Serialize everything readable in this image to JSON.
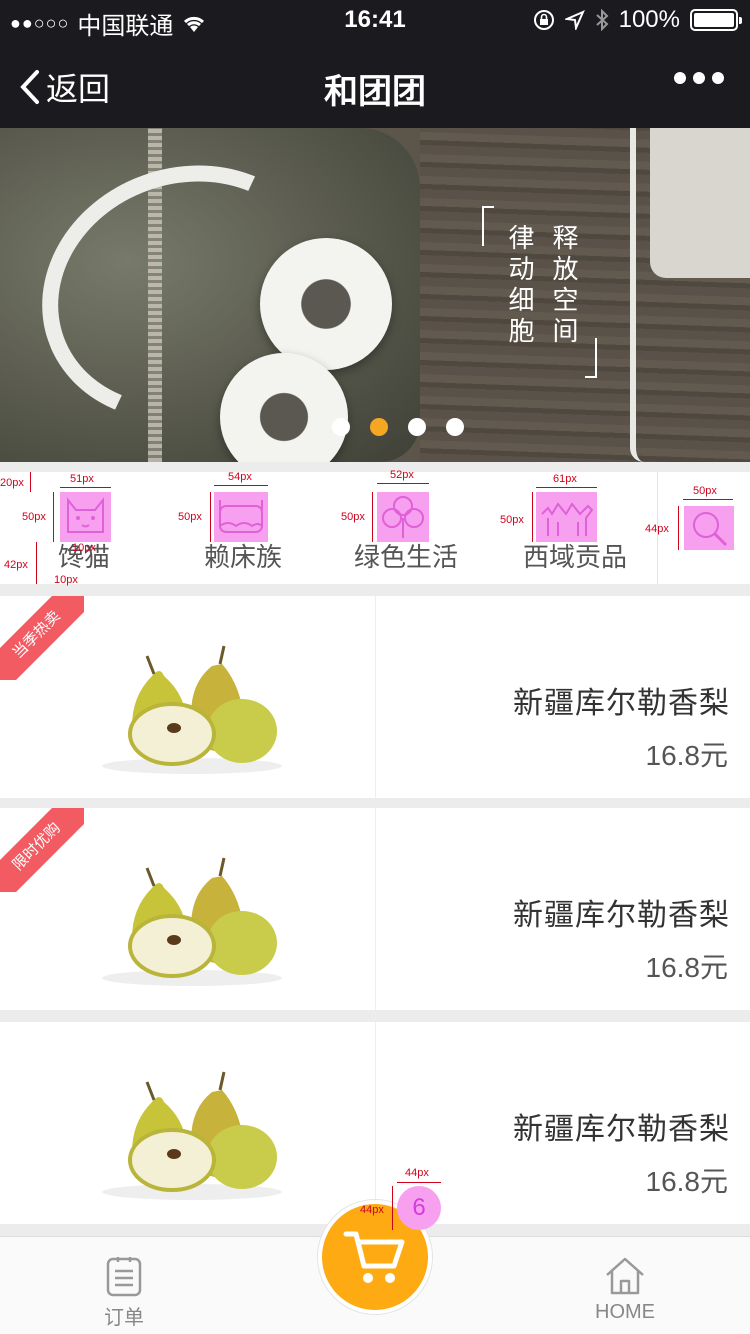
{
  "status_bar": {
    "signal": "●●○○○",
    "carrier": "中国联通",
    "time": "16:41",
    "battery_percent": "100%"
  },
  "nav": {
    "back_label": "返回",
    "title": "和团团"
  },
  "banner": {
    "column_right": "释放空间",
    "column_left": "律动细胞",
    "slide_count": 4,
    "active_slide": 2
  },
  "categories": [
    {
      "label": "馋猫",
      "icon": "cat-icon"
    },
    {
      "label": "赖床族",
      "icon": "bed-icon"
    },
    {
      "label": "绿色生活",
      "icon": "clover-icon"
    },
    {
      "label": "西域贡品",
      "icon": "camel-icon"
    }
  ],
  "search_icon": "search-icon",
  "annotations": {
    "a_20": "20px",
    "a_51": "51px",
    "a_50a": "50px",
    "a_42": "42px",
    "a_10a": "10px",
    "a_10b": "10px",
    "a_54": "54px",
    "a_50b": "50px",
    "a_52": "52px",
    "a_50c": "50px",
    "a_61": "61px",
    "a_50d": "50px",
    "a_50e": "50px",
    "a_44a": "44px",
    "a_44b": "44px",
    "a_44c": "44px"
  },
  "products": [
    {
      "name": "新疆库尔勒香梨",
      "price": "16.8元",
      "ribbon": "当季热卖",
      "ribbon_icon": "sprout-icon"
    },
    {
      "name": "新疆库尔勒香梨",
      "price": "16.8元",
      "ribbon": "限时优购",
      "ribbon_icon": "clock-icon"
    },
    {
      "name": "新疆库尔勒香梨",
      "price": "16.8元",
      "ribbon": "",
      "ribbon_icon": ""
    }
  ],
  "cart": {
    "badge_count": "6",
    "icon": "cart-icon"
  },
  "tabs": [
    {
      "label": "订单",
      "icon": "order-list-icon"
    },
    {
      "label": "HOME",
      "icon": "home-icon"
    }
  ],
  "colors": {
    "nav_bg": "#1b1b1f",
    "accent": "#fdaa13",
    "ribbon": "#f35b63",
    "dot_active": "#f5a623",
    "placeholder_highlight": "#f8a0f0"
  }
}
